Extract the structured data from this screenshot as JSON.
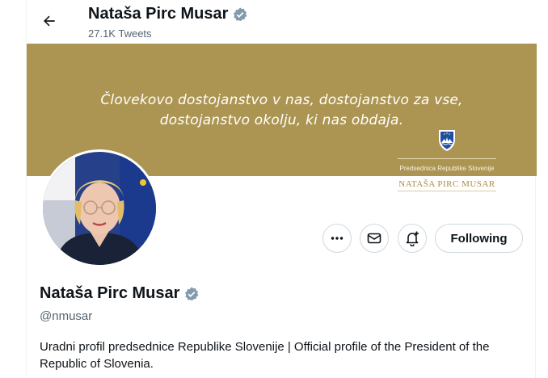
{
  "header": {
    "back_icon": "arrow-left-icon",
    "name": "Nataša Pirc Musar",
    "verified_icon": "verified-badge-icon",
    "tweet_count": "27.1K Tweets"
  },
  "banner": {
    "quote": "Človekovo dostojanstvo v nas, dostojanstvo za vse, dostojanstvo okolju, ki nas obdaja.",
    "coat_of_arms_icon": "slovenia-coat-of-arms-icon",
    "office_title": "Predsednica Republike Slovenije",
    "signature_name": "NATAŠA PIRC MUSAR",
    "background_color": "#ac9552"
  },
  "profile": {
    "avatar": "profile-photo",
    "name": "Nataša Pirc Musar",
    "handle": "@nmusar",
    "bio": "Uradni profil predsednice Republike Slovenije | Official profile of the President of the Republic of Slovenia."
  },
  "actions": {
    "more_icon": "more-horizontal-icon",
    "message_icon": "envelope-icon",
    "notify_icon": "bell-plus-icon",
    "follow_label": "Following"
  }
}
